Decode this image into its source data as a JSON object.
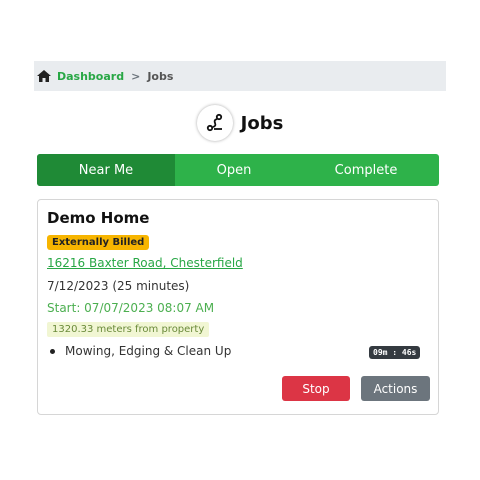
{
  "breadcrumb": {
    "home_label": "Dashboard",
    "separator": ">",
    "current": "Jobs",
    "icon": "home-icon"
  },
  "header": {
    "title": "Jobs",
    "icon": "route-icon"
  },
  "tabs": [
    {
      "label": "Near Me",
      "active": true
    },
    {
      "label": "Open",
      "active": false
    },
    {
      "label": "Complete",
      "active": false
    }
  ],
  "job": {
    "title": "Demo Home",
    "billing_badge": "Externally Billed",
    "address": "16216 Baxter Road, Chesterfield",
    "date_line": "7/12/2023 (25 minutes)",
    "start_line": "Start: 07/07/2023 08:07 AM",
    "distance": "1320.33 meters from property",
    "service": "Mowing, Edging & Clean Up",
    "timer": "09m : 46s",
    "stop_label": "Stop",
    "actions_label": "Actions"
  },
  "colors": {
    "accent": "#28a745",
    "tab_active": "#1f8a36",
    "badge": "#f7b500",
    "danger": "#dc3545",
    "secondary": "#6c757d"
  }
}
